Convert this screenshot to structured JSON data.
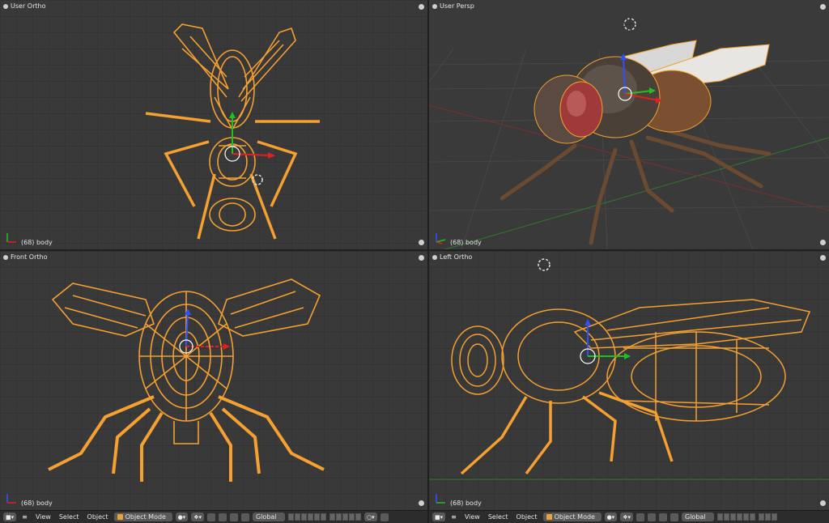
{
  "viewports": {
    "top_left": {
      "title": "User Ortho",
      "object_label": "(68) body"
    },
    "top_right": {
      "title": "User Persp",
      "object_label": "(68) body"
    },
    "bottom_left": {
      "title": "Front Ortho",
      "object_label": "(68) body"
    },
    "bottom_right": {
      "title": "Left Ortho",
      "object_label": "(68) body"
    }
  },
  "header": {
    "menu_view": "View",
    "menu_select": "Select",
    "menu_object": "Object",
    "mode": "Object Mode",
    "orientation": "Global"
  },
  "colors": {
    "wire": "#f5a030",
    "viewport_bg": "#393939",
    "axis_x": "#e02020",
    "axis_y": "#20c020",
    "axis_z": "#3050ff"
  },
  "icons": [
    "viewport-type-icon",
    "cursor-icon",
    "manipulator-icon",
    "layers-icon",
    "lock-icon"
  ]
}
